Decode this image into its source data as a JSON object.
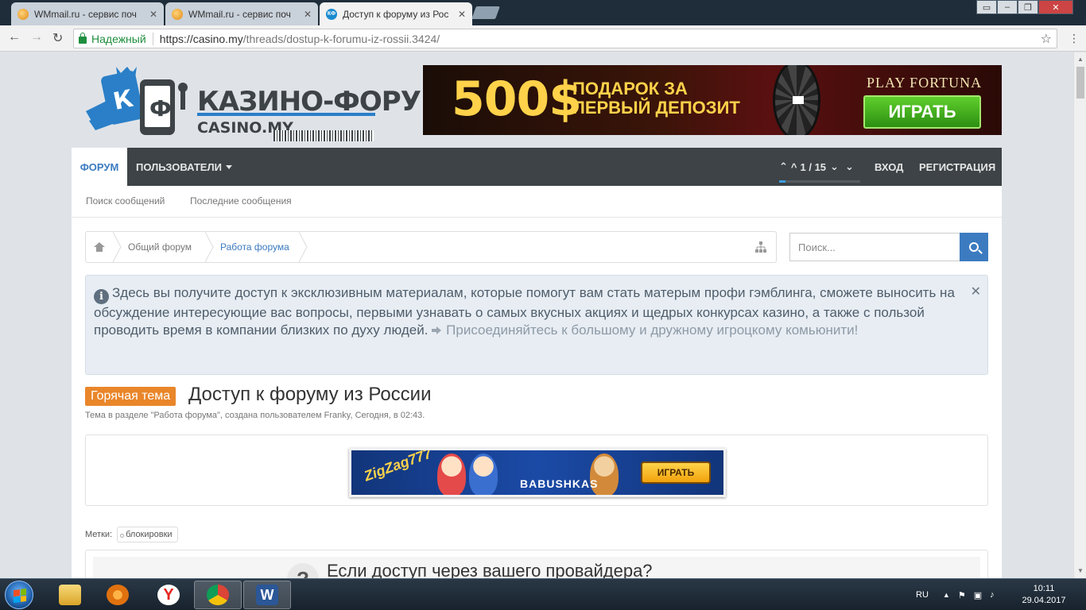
{
  "browser": {
    "tabs": [
      {
        "title": "WMmail.ru - сервис поч"
      },
      {
        "title": "WMmail.ru - сервис поч"
      },
      {
        "title": "Доступ к форуму из Рос"
      }
    ],
    "secure_label": "Надежный",
    "url_host": "https://casino.my",
    "url_path": "/threads/dostup-k-forumu-iz-rossii.3424/"
  },
  "logo": {
    "name": "КАЗИНО-ФОРУМ",
    "domain": "CASINO.MY"
  },
  "top_banner": {
    "amount": "500$",
    "line1": "ПОДАРОК ЗА",
    "line2": "ПЕРВЫЙ ДЕПОЗИТ",
    "brand": "PLAY FORTUNA",
    "button": "ИГРАТЬ"
  },
  "nav": {
    "forum": "ФОРУМ",
    "users": "ПОЛЬЗОВАТЕЛИ",
    "pager": "1 / 15",
    "login": "ВХОД",
    "register": "РЕГИСТРАЦИЯ"
  },
  "subnav": {
    "search_posts": "Поиск сообщений",
    "recent_posts": "Последние сообщения"
  },
  "breadcrumb": {
    "items": [
      "Общий форум",
      "Работа форума"
    ]
  },
  "search": {
    "placeholder": "Поиск..."
  },
  "notice": {
    "text": "Здесь вы получите доступ к эксклюзивным материалам, которые помогут вам стать матерым профи гэмблинга, сможете выносить на обсуждение интересующие вас вопросы, первыми узнавать о самых вкусных акциях и щедрых конкурсах казино, а также с пользой проводить время в компании близких по духу людей.",
    "join": "Присоединяйтесь к большому и дружному игроцкому комьюнити!"
  },
  "thread": {
    "badge": "Горячая тема",
    "title": "Доступ к форуму из России",
    "meta": "Тема в разделе \"Работа форума\", создана пользователем Franky, Сегодня, в 02:43."
  },
  "ad2": {
    "brand": "BABUSHKAS",
    "button": "ИГРАТЬ"
  },
  "tags": {
    "label": "Метки:",
    "items": [
      "блокировки"
    ]
  },
  "post": {
    "title": "Если доступ через вашего провайдера?"
  },
  "taskbar": {
    "lang": "RU",
    "time": "10:11",
    "date": "29.04.2017"
  }
}
